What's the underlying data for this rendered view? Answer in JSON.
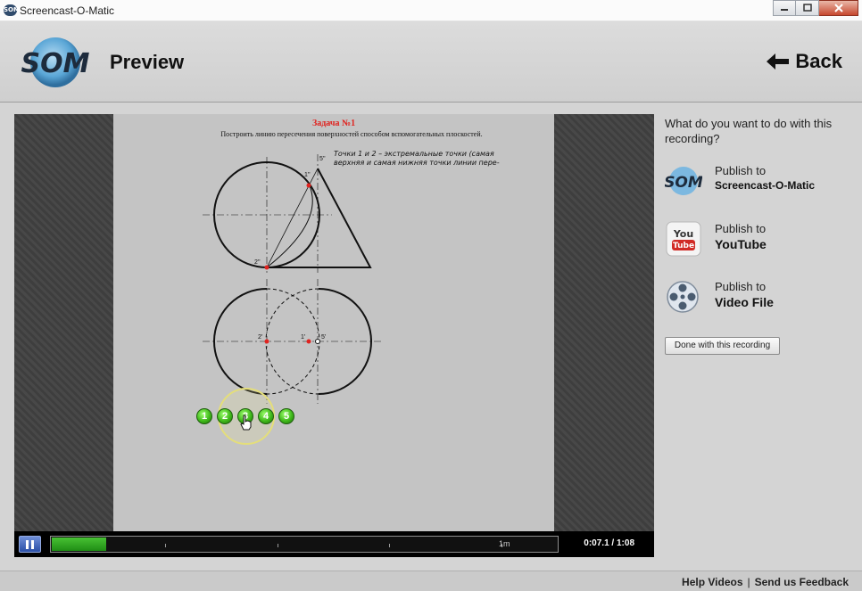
{
  "window": {
    "title": "Screencast-O-Matic",
    "logo_text": "SOM"
  },
  "header": {
    "logo_text": "SOM",
    "title": "Preview",
    "back_label": "Back"
  },
  "slide": {
    "title": "Задача №1",
    "subtitle": "Построить линию пересечения поверхностей способом вспомогательных плоскостей.",
    "note_line1": "Точки 1 и 2 – экстремальные точки (самая",
    "note_line2": "верхняя и самая нижняя точки линии пере-",
    "point_labels": {
      "top_upper": "5''",
      "top_right": "1''",
      "top_lower": "2''",
      "bottom_left": "2'",
      "bottom_mid": "1'",
      "bottom_right": "5'"
    },
    "steps": [
      "1",
      "2",
      "3",
      "4",
      "5"
    ],
    "active_step": "3"
  },
  "player": {
    "state": "playing",
    "progress_fraction": 0.107,
    "tick_label": "1m",
    "current_time": "0:07.1",
    "time_separator": "/",
    "total_time": "1:08"
  },
  "side": {
    "prompt": "What do you want to do with this recording?",
    "options": [
      {
        "line1": "Publish to",
        "line2": "Screencast-O-Matic",
        "icon": "som-logo-icon"
      },
      {
        "line1": "Publish to",
        "line2": "YouTube",
        "icon": "youtube-icon",
        "icon_top": "You",
        "icon_bottom": "Tube"
      },
      {
        "line1": "Publish to",
        "line2": "Video File",
        "icon": "film-reel-icon"
      }
    ],
    "done_label": "Done with this recording"
  },
  "footer": {
    "help_label": "Help Videos",
    "separator": "|",
    "feedback_label": "Send us Feedback"
  },
  "colors": {
    "accent_green": "#3fb81a",
    "title_red": "#e0231f",
    "pause_blue": "#2a4ea5",
    "youtube_red": "#d12b26"
  }
}
